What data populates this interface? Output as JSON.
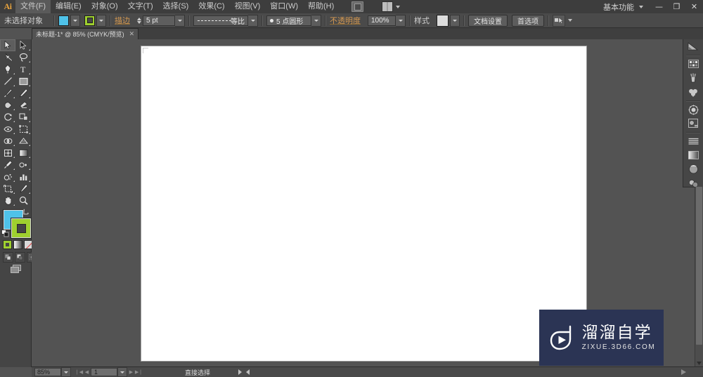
{
  "app": {
    "logo": "Ai",
    "workspace": "基本功能",
    "window_minimize": "—",
    "window_restore": "❐",
    "window_close": "✕"
  },
  "menubar": {
    "items": [
      {
        "label": "文件(F)",
        "active": true
      },
      {
        "label": "编辑(E)",
        "active": false
      },
      {
        "label": "对象(O)",
        "active": false
      },
      {
        "label": "文字(T)",
        "active": false
      },
      {
        "label": "选择(S)",
        "active": false
      },
      {
        "label": "效果(C)",
        "active": false
      },
      {
        "label": "视图(V)",
        "active": false
      },
      {
        "label": "窗口(W)",
        "active": false
      },
      {
        "label": "帮助(H)",
        "active": false
      }
    ],
    "bridge_icon": "bridge-icon",
    "arrange_icon": "arrange-documents-icon"
  },
  "controlbar": {
    "selection_status": "未选择对象",
    "fill_label": "fill-swatch",
    "fill_color": "#4fc2e9",
    "stroke_label": "描边",
    "stroke_color": "#9fd02f",
    "stroke_weight": "5 pt",
    "variable_width_profile": "等比",
    "brush_definition": "5 点圆形",
    "opacity_label": "不透明度",
    "opacity_value": "100%",
    "style_label": "样式",
    "document_setup": "文档设置",
    "preferences": "首选项",
    "select_similar": "select-similar-objects-icon"
  },
  "tabbar": {
    "document_tab": "未标题-1* @ 85% (CMYK/预览)",
    "close_glyph": "✕"
  },
  "toolbar": {
    "tools": [
      {
        "name": "selection-tool",
        "selected": true
      },
      {
        "name": "direct-selection-tool",
        "selected": false
      },
      {
        "name": "magic-wand-tool",
        "selected": false
      },
      {
        "name": "lasso-tool",
        "selected": false
      },
      {
        "name": "pen-tool",
        "selected": false
      },
      {
        "name": "type-tool",
        "selected": false
      },
      {
        "name": "line-segment-tool",
        "selected": false
      },
      {
        "name": "rectangle-tool",
        "selected": false
      },
      {
        "name": "paintbrush-tool",
        "selected": false
      },
      {
        "name": "pencil-tool",
        "selected": false
      },
      {
        "name": "blob-brush-tool",
        "selected": false
      },
      {
        "name": "eraser-tool",
        "selected": false
      },
      {
        "name": "rotate-tool",
        "selected": false
      },
      {
        "name": "scale-tool",
        "selected": false
      },
      {
        "name": "width-tool",
        "selected": false
      },
      {
        "name": "free-transform-tool",
        "selected": false
      },
      {
        "name": "shape-builder-tool",
        "selected": false
      },
      {
        "name": "perspective-grid-tool",
        "selected": false
      },
      {
        "name": "mesh-tool",
        "selected": false
      },
      {
        "name": "gradient-tool",
        "selected": false
      },
      {
        "name": "eyedropper-tool",
        "selected": false
      },
      {
        "name": "blend-tool",
        "selected": false
      },
      {
        "name": "symbol-sprayer-tool",
        "selected": false
      },
      {
        "name": "column-graph-tool",
        "selected": false
      },
      {
        "name": "artboard-tool",
        "selected": false
      },
      {
        "name": "slice-tool",
        "selected": false
      },
      {
        "name": "hand-tool",
        "selected": false
      },
      {
        "name": "zoom-tool",
        "selected": false
      }
    ],
    "fill_color": "#4fc2e9",
    "stroke_color": "#9fd02f",
    "color_modes": [
      "color-mode",
      "gradient-mode",
      "none-mode"
    ],
    "draw_modes": [
      "draw-normal",
      "draw-behind",
      "draw-inside"
    ],
    "screen_mode": "change-screen-mode"
  },
  "right_dock": {
    "panels": [
      {
        "name": "color-panel-icon"
      },
      {
        "name": "swatches-panel-icon"
      },
      {
        "name": "brushes-panel-icon"
      },
      {
        "name": "symbols-panel-icon"
      },
      {
        "name": "transparency-panel-icon"
      },
      {
        "name": "appearance-panel-icon"
      },
      {
        "name": "align-panel-icon"
      },
      {
        "name": "gradient-panel-icon"
      },
      {
        "name": "stroke-panel-icon"
      },
      {
        "name": "graphic-styles-panel-icon"
      }
    ]
  },
  "statusbar": {
    "zoom": "85%",
    "page": "1",
    "status_text": "直接选择"
  },
  "canvas": {
    "artboard_background": "#ffffff",
    "workspace_background": "#535353"
  },
  "watermark": {
    "title": "溜溜自学",
    "subtitle": "ZIXUE.3D66.COM",
    "background": "#2b3454"
  }
}
